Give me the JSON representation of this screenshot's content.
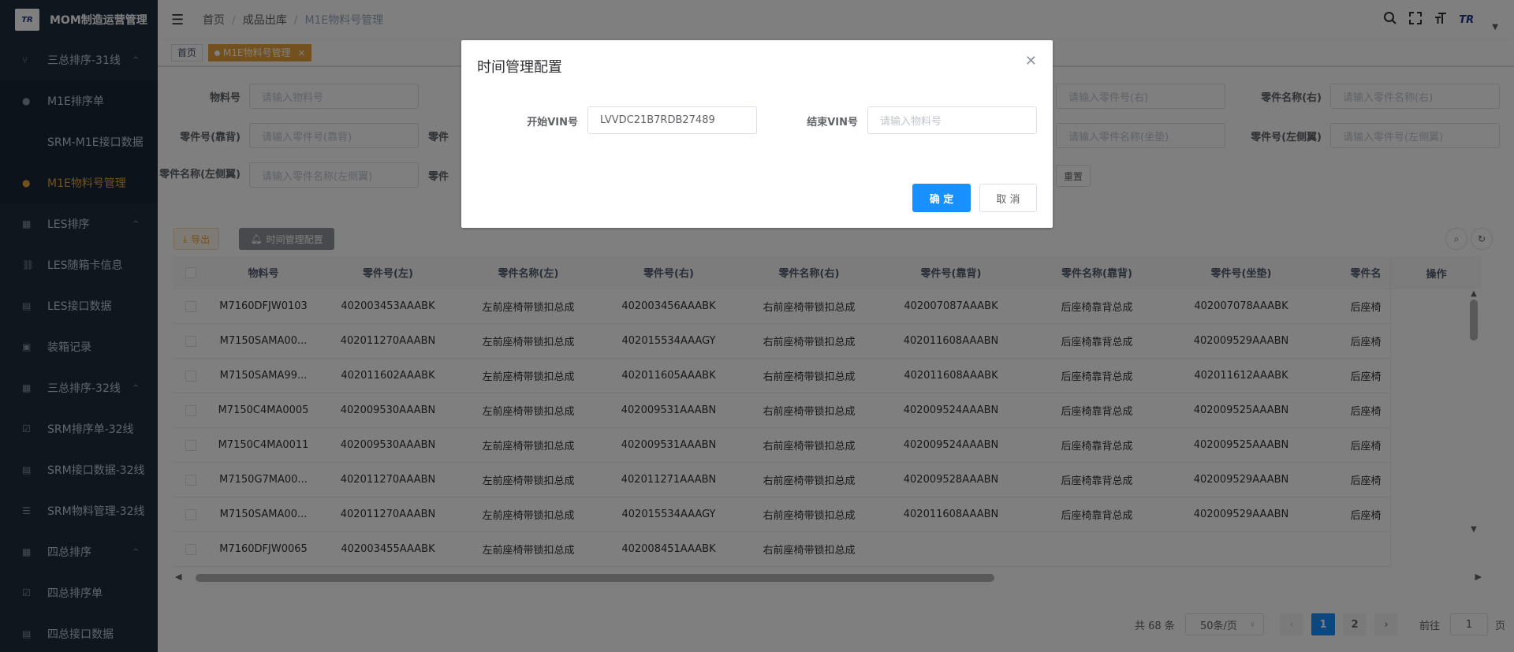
{
  "app": {
    "title": "MOM制造运营管理",
    "logo_text": "TR"
  },
  "sidebar": {
    "items": [
      {
        "label": "三总排序-31线",
        "icon": "branch-icon",
        "arrow": "^"
      },
      {
        "label": "M1E排序单",
        "icon": "user-icon"
      },
      {
        "label": "SRM-M1E接口数据",
        "icon": ""
      },
      {
        "label": "M1E物料号管理",
        "icon": "user-icon"
      },
      {
        "label": "LES排序",
        "icon": "grid-icon",
        "arrow": "^"
      },
      {
        "label": "LES随箱卡信息",
        "icon": "link-icon"
      },
      {
        "label": "LES接口数据",
        "icon": "table-icon"
      },
      {
        "label": "装箱记录",
        "icon": "box-icon"
      },
      {
        "label": "三总排序-32线",
        "icon": "grid-icon",
        "arrow": "^"
      },
      {
        "label": "SRM排序单-32线",
        "icon": "check-icon"
      },
      {
        "label": "SRM接口数据-32线",
        "icon": "table-icon"
      },
      {
        "label": "SRM物料管理-32线",
        "icon": "list-icon"
      },
      {
        "label": "四总排序",
        "icon": "grid-icon",
        "arrow": "^"
      },
      {
        "label": "四总排序单",
        "icon": "check-icon"
      },
      {
        "label": "四总接口数据",
        "icon": "table-icon"
      }
    ]
  },
  "header": {
    "breadcrumb": [
      "首页",
      "成品出库",
      "M1E物料号管理"
    ],
    "hdr_logo": "TR"
  },
  "tags": {
    "home": "首页",
    "active": "M1E物料号管理",
    "close": "×"
  },
  "search": {
    "f1_label": "物料号",
    "f1_ph": "请输入物料号",
    "f2_label": "零件名称(右)",
    "f2_ph": "请输入零件名称(右)",
    "f3_ph": "请输入零件号(右)",
    "f4_label": "零件号(靠背)",
    "f4_ph": "请输入零件号(靠背)",
    "f4b_label": "零件",
    "f5_ph": "请输入零件名称(坐垫)",
    "f6_label": "零件号(左侧翼)",
    "f6_ph": "请输入零件号(左侧翼)",
    "f7_label": "零件名称(左侧翼)",
    "f7_ph": "请输入零件名称(左侧翼)",
    "f7b_label": "零件",
    "reset": "重置"
  },
  "toolbar": {
    "export": "导出",
    "time_config": "时间管理配置"
  },
  "table": {
    "headers": [
      "物料号",
      "零件号(左)",
      "零件名称(左)",
      "零件号(右)",
      "零件名称(右)",
      "零件号(靠背)",
      "零件名称(靠背)",
      "零件号(坐垫)",
      "零件名"
    ],
    "op_header": "操作",
    "rows": [
      [
        "M7160DFJW0103",
        "402003453AAABK",
        "左前座椅带锁扣总成",
        "402003456AAABK",
        "右前座椅带锁扣总成",
        "402007087AAABK",
        "后座椅靠背总成",
        "402007078AAABK",
        "后座椅"
      ],
      [
        "M7150SAMA00...",
        "402011270AAABN",
        "左前座椅带锁扣总成",
        "402015534AAAGY",
        "右前座椅带锁扣总成",
        "402011608AAABN",
        "后座椅靠背总成",
        "402009529AAABN",
        "后座椅"
      ],
      [
        "M7150SAMA99...",
        "402011602AAABK",
        "左前座椅带锁扣总成",
        "402011605AAABK",
        "右前座椅带锁扣总成",
        "402011608AAABK",
        "后座椅靠背总成",
        "402011612AAABK",
        "后座椅"
      ],
      [
        "M7150C4MA0005",
        "402009530AAABN",
        "左前座椅带锁扣总成",
        "402009531AAABN",
        "右前座椅带锁扣总成",
        "402009524AAABN",
        "后座椅靠背总成",
        "402009525AAABN",
        "后座椅"
      ],
      [
        "M7150C4MA0011",
        "402009530AAABN",
        "左前座椅带锁扣总成",
        "402009531AAABN",
        "右前座椅带锁扣总成",
        "402009524AAABN",
        "后座椅靠背总成",
        "402009525AAABN",
        "后座椅"
      ],
      [
        "M7150G7MA00...",
        "402011270AAABN",
        "左前座椅带锁扣总成",
        "402011271AAABN",
        "右前座椅带锁扣总成",
        "402009528AAABN",
        "后座椅靠背总成",
        "402009529AAABN",
        "后座椅"
      ],
      [
        "M7150SAMA00...",
        "402011270AAABN",
        "左前座椅带锁扣总成",
        "402015534AAAGY",
        "右前座椅带锁扣总成",
        "402011608AAABN",
        "后座椅靠背总成",
        "402009529AAABN",
        "后座椅"
      ],
      [
        "M7160DFJW0065",
        "402003455AAABK",
        "左前座椅带锁扣总成",
        "402008451AAABK",
        "右前座椅带锁扣总成",
        "",
        "",
        "",
        ""
      ]
    ]
  },
  "pager": {
    "total": "共 68 条",
    "size": "50条/页",
    "p1": "1",
    "p2": "2",
    "goto": "前往",
    "goto_val": "1",
    "page": "页"
  },
  "dialog": {
    "title": "时间管理配置",
    "start_label": "开始VIN号",
    "start_value": "LVVDC21B7RDB27489",
    "end_label": "结束VIN号",
    "end_ph": "请输入物料号",
    "confirm": "确 定",
    "cancel": "取 消"
  },
  "colors": {
    "accent": "#e6a23c",
    "primary": "#1890ff",
    "sidebar": "#1f2d3d"
  }
}
